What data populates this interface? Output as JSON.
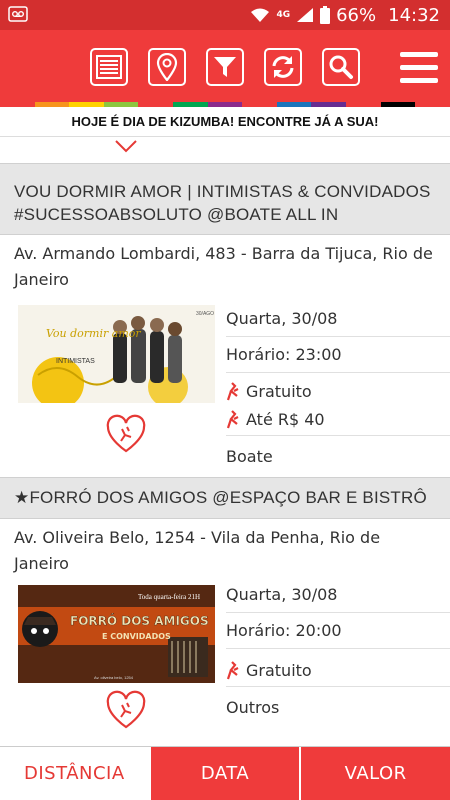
{
  "status": {
    "network": "4G",
    "battery": "66%",
    "time": "14:32"
  },
  "toolbar": {
    "icons": [
      "list-icon",
      "location-pin-icon",
      "filter-icon",
      "refresh-icon",
      "search-icon",
      "menu-icon"
    ]
  },
  "banner": {
    "text": "HOJE É DIA DE KIZUMBA! ENCONTRE JÁ A SUA!"
  },
  "colors": {
    "brand": "#ef3b3b",
    "active_tab_text": "#e53935"
  },
  "events": [
    {
      "title": "VOU DORMIR AMOR | INTIMISTAS & CONVIDADOS #SUCESSOABSOLUTO @BOATE ALL IN",
      "address": "Av. Armando Lombardi, 483 - Barra da Tijuca, Rio de Janeiro",
      "date": "Quarta, 30/08",
      "time": "Horário: 23:00",
      "prices": [
        "Gratuito",
        "Até R$ 40"
      ],
      "category": "Boate",
      "flyer": {
        "header": "30/AGO",
        "script": "Vou dormir amor",
        "subtitle": "INTIMISTAS"
      }
    },
    {
      "title": "★FORRÓ DOS AMIGOS @ESPAÇO BAR E BISTRÔ",
      "address": "Av. Oliveira Belo, 1254 - Vila da Penha, Rio de Janeiro",
      "date": "Quarta, 30/08",
      "time": "Horário: 20:00",
      "prices": [
        "Gratuito"
      ],
      "category": "Outros",
      "flyer": {
        "header": "Toda quarta-feira 21H",
        "title": "FORRÓ DOS AMIGOS",
        "subtitle": "E CONVIDADOS",
        "footer": "Av. oliveira belo, 1254"
      }
    }
  ],
  "tabs": [
    {
      "label": "DISTÂNCIA",
      "active": true
    },
    {
      "label": "DATA",
      "active": false
    },
    {
      "label": "VALOR",
      "active": false
    }
  ]
}
